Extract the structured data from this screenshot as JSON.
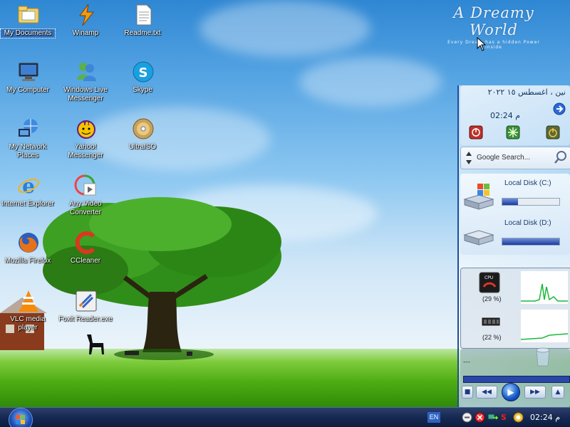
{
  "desktop": {
    "brand": {
      "title": "A Dreamy World",
      "tagline": "Every Dream has a hidden Power inside"
    },
    "icons": [
      {
        "label": "My Documents",
        "icon": "folder-documents-icon",
        "selected": true
      },
      {
        "label": "Winamp",
        "icon": "winamp-icon"
      },
      {
        "label": "Readme.txt",
        "icon": "text-file-icon"
      },
      {
        "label": "My Computer",
        "icon": "computer-icon"
      },
      {
        "label": "Windows Live Messenger",
        "icon": "messenger-icon"
      },
      {
        "label": "Skype",
        "icon": "skype-icon"
      },
      {
        "label": "My Network Places",
        "icon": "network-icon"
      },
      {
        "label": "Yahoo! Messenger",
        "icon": "yahoo-icon"
      },
      {
        "label": "UltraISO",
        "icon": "disc-icon"
      },
      {
        "label": "Internet Explorer",
        "icon": "ie-icon"
      },
      {
        "label": "Any Video Converter",
        "icon": "video-converter-icon"
      },
      {
        "label": "Mozilla Firefox",
        "icon": "firefox-icon"
      },
      {
        "label": "CCleaner",
        "icon": "ccleaner-icon"
      },
      {
        "label": "VLC media player",
        "icon": "vlc-icon"
      },
      {
        "label": "Foxit Reader.exe",
        "icon": "pdf-reader-icon"
      }
    ]
  },
  "sidebar": {
    "clock": {
      "date": "ﻧﯿﻦ ، اغسطس ١٥ ٢٠٢٢",
      "time": "م 02:24"
    },
    "search": {
      "placeholder": "Google Search..."
    },
    "disks": [
      {
        "label": "Local Disk (C:)",
        "used_fraction": 0.28
      },
      {
        "label": "Local Disk (D:)",
        "used_fraction": 1.0
      }
    ],
    "performance": {
      "cpu_label": "CPU",
      "cpu_percent": "(29 %)",
      "ram_percent": "(22 %)"
    },
    "media": {
      "time": "---"
    }
  },
  "taskbar": {
    "language": "EN",
    "clock": "م 02:24",
    "tray_icons": [
      "messenger-tray-icon",
      "shield-tray-icon",
      "network-tray-icon",
      "s-tray-icon",
      "update-tray-icon"
    ]
  },
  "colors": {
    "accent": "#1f4e9a",
    "taskbar": "#172a54"
  }
}
